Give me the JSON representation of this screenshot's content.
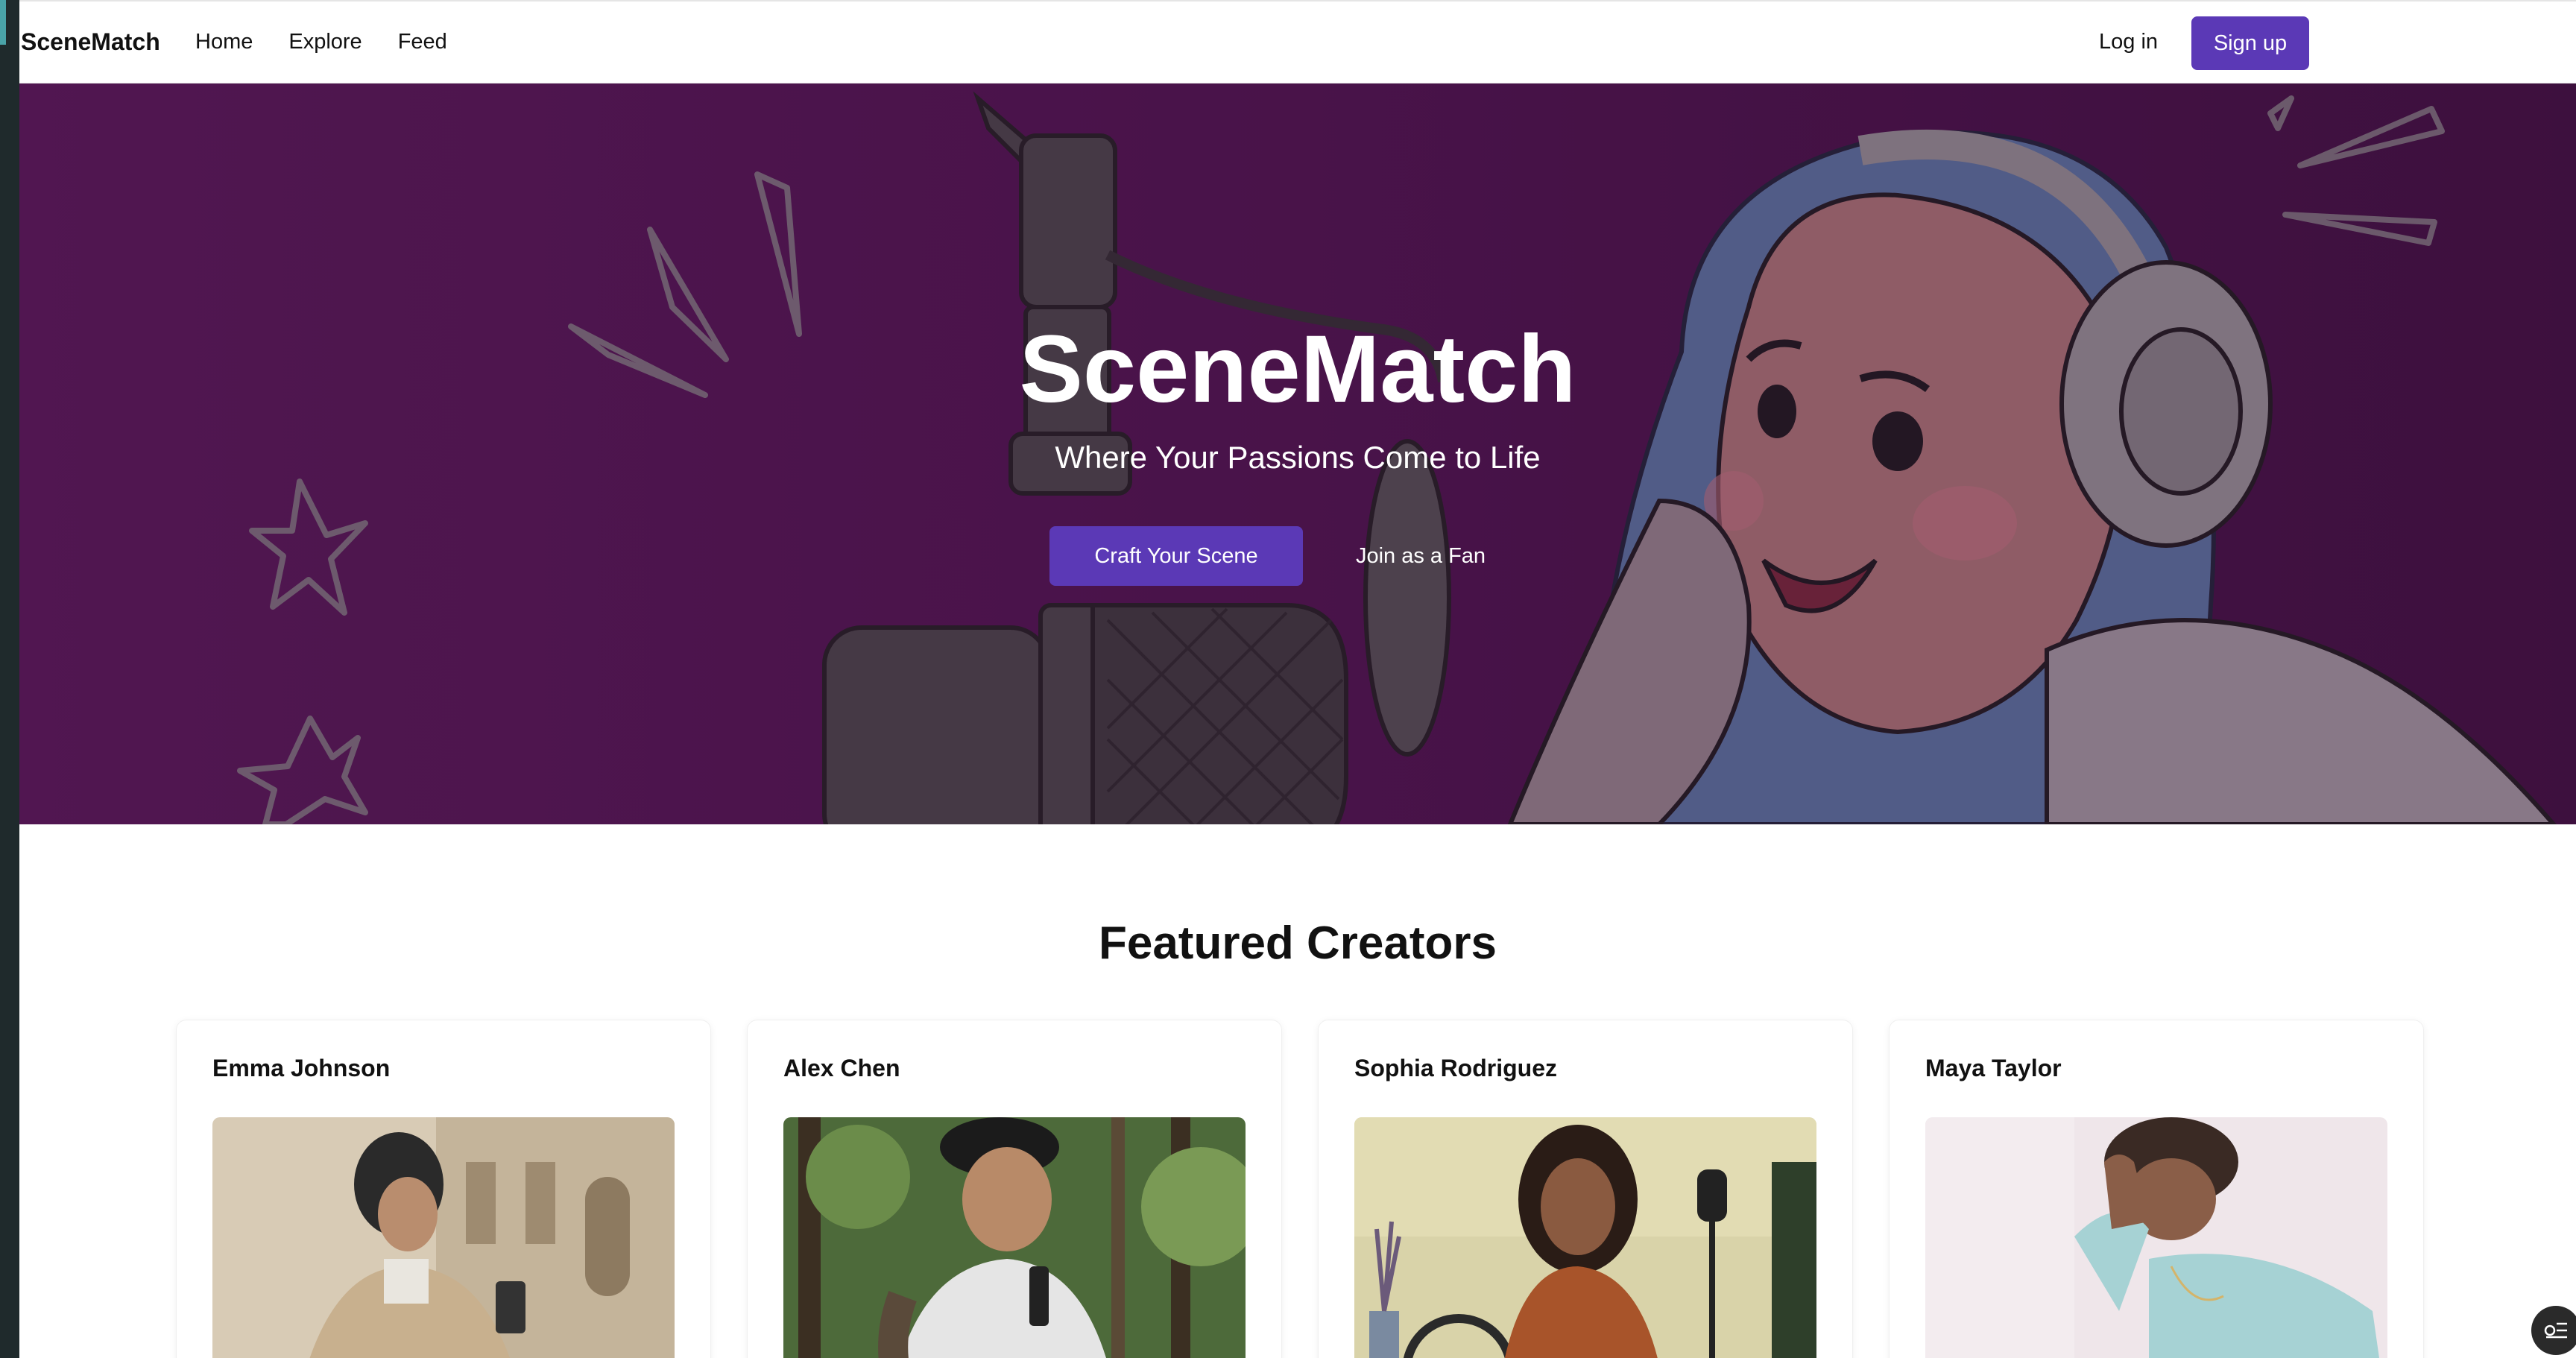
{
  "nav": {
    "brand": "SceneMatch",
    "links": [
      "Home",
      "Explore",
      "Feed"
    ],
    "login": "Log in",
    "signup": "Sign up"
  },
  "hero": {
    "title": "SceneMatch",
    "subtitle": "Where Your Passions Come to Life",
    "cta_primary": "Craft Your Scene",
    "cta_secondary": "Join as a Fan"
  },
  "featured": {
    "title": "Featured Creators",
    "creators": [
      {
        "name": "Emma Johnson"
      },
      {
        "name": "Alex Chen"
      },
      {
        "name": "Sophia Rodriguez"
      },
      {
        "name": "Maya Taylor"
      }
    ]
  },
  "colors": {
    "accent": "#5b39b6",
    "hero_bg": "#4f1550"
  },
  "icons": {
    "fab": "list-settings-icon"
  }
}
